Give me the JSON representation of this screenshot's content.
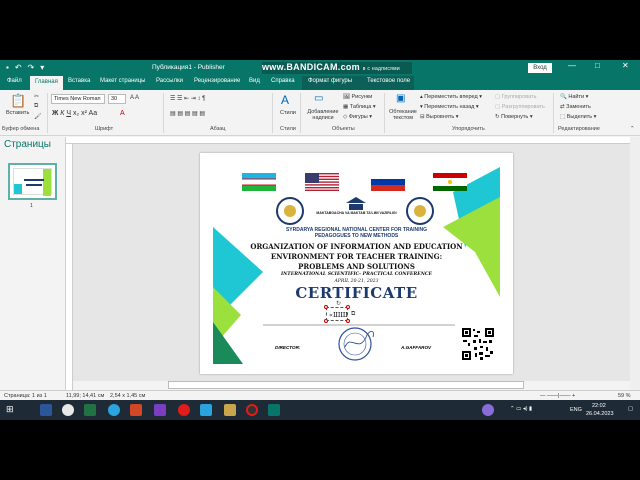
{
  "window": {
    "title": "Публикация1 - Publisher",
    "bandicam": "www.BANDICAM.com",
    "bandicam_sub": "в с надписями",
    "login": "Вход"
  },
  "tabs": [
    "Файл",
    "Главная",
    "Вставка",
    "Макет страницы",
    "Рассылки",
    "Рецензирование",
    "Вид",
    "Справка",
    "Формат фигуры",
    "Текстовое поле"
  ],
  "ribbon": {
    "paste": "Вставить",
    "clipboard": "Буфер обмена",
    "font_name": "Times New Roman",
    "font_size": "30",
    "font_group": "Шрифт",
    "paragraph_group": "Абзац",
    "styles": "Стили",
    "styles_group": "Стили",
    "add_textbox": "Добавление надписи",
    "pictures": "Рисунки",
    "table": "Таблица",
    "shapes": "Фигуры",
    "objects_group": "Объекты",
    "wrap_text": "Обтекание текстом",
    "bring_forward": "Переместить вперед",
    "send_backward": "Переместить назад",
    "align": "Выровнять",
    "group": "Группировать",
    "ungroup": "Разгруппировать",
    "rotate": "Повернуть",
    "arrange_group": "Упорядочить",
    "find": "Найти",
    "replace": "Заменить",
    "select": "Выделить",
    "editing_group": "Редактирование"
  },
  "pages_pane": {
    "title": "Страницы",
    "page_number": "1"
  },
  "certificate": {
    "center_logo_text": "MAKTABGACHA VA MAKTAB TA'LIMI VAZIRLIGI",
    "center_line1": "SYRDARYA REGIONAL NATIONAL CENTER FOR TRAINING",
    "center_line2": "PEDAGOGUES TO NEW METHODS",
    "org_line1": "ORGANIZATION OF INFORMATION AND EDUCATION",
    "org_line2": "ENVIRONMENT FOR TEACHER TRAINING:",
    "org_line3": "PROBLEMS AND SOLUTIONS",
    "conference": "INTERNATIONAL SCIENTIFIC- PRACTICAL CONFERENCE",
    "date": "APRIL 20-21, 2023",
    "title": "CERTIFICATE",
    "selected_text": "«ШШ",
    "director_label": "DIRECTOR:",
    "director_name": "A.GAFFAROV"
  },
  "statusbar": {
    "page": "Страница: 1 из 1",
    "position": "11,99; 14,41 см",
    "size": "2,54 x 1,45 см",
    "zoom": "59 %"
  },
  "taskbar": {
    "language": "ENG",
    "time": "22:02",
    "date": "26.04.2023"
  },
  "colors": {
    "accent": "#077568",
    "cert_navy": "#1d3a6e",
    "cert_cyan": "#1fc7d4",
    "cert_green": "#9be03c"
  }
}
